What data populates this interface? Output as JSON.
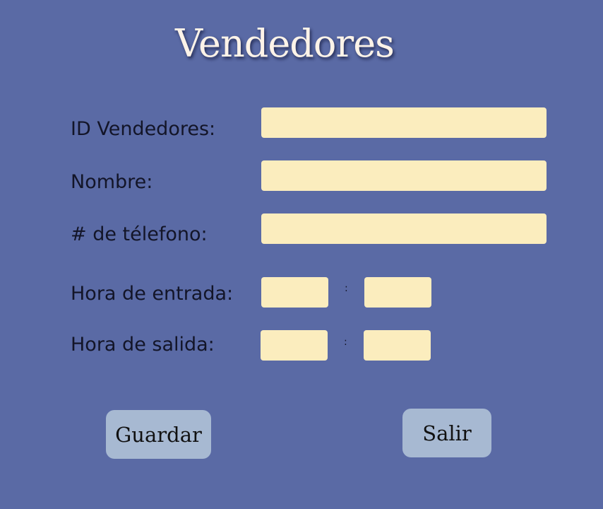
{
  "form": {
    "title": "Vendedores",
    "fields": {
      "id_vendedores": {
        "label": "ID Vendedores:",
        "value": ""
      },
      "nombre": {
        "label": "Nombre:",
        "value": ""
      },
      "telefono": {
        "label": "# de télefono:",
        "value": ""
      },
      "hora_entrada": {
        "label": "Hora de entrada:",
        "hours": "",
        "minutes": "",
        "separator": ":"
      },
      "hora_salida": {
        "label": "Hora de salida:",
        "hours": "",
        "minutes": "",
        "separator": ":"
      }
    },
    "buttons": {
      "save_label": "Guardar",
      "exit_label": "Salir"
    }
  },
  "colors": {
    "background": "#5a6aa5",
    "input_fill": "#fbedbe",
    "button_fill": "#a7b9d2",
    "title_text": "#fdf3e8"
  }
}
